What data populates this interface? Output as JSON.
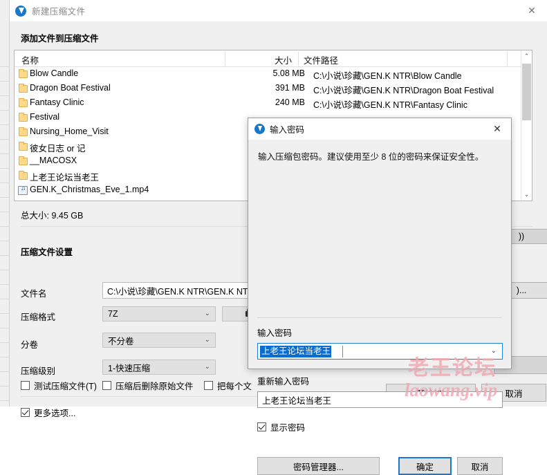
{
  "window": {
    "title": "新建压缩文件",
    "close_label": "✕",
    "section_title": "添加文件到压缩文件",
    "app_icon": "archiver-icon"
  },
  "filelist": {
    "columns": [
      "名称",
      "大小",
      "文件路径"
    ],
    "rows": [
      {
        "icon": "folder-icon",
        "name": "Blow Candle",
        "size": "5.08 MB",
        "path": "C:\\小说\\珍藏\\GEN.K NTR\\Blow Candle"
      },
      {
        "icon": "folder-icon",
        "name": "Dragon Boat Festival",
        "size": "391 MB",
        "path": "C:\\小说\\珍藏\\GEN.K NTR\\Dragon Boat Festival"
      },
      {
        "icon": "folder-icon",
        "name": "Fantasy Clinic",
        "size": "240 MB",
        "path": "C:\\小说\\珍藏\\GEN.K NTR\\Fantasy Clinic"
      },
      {
        "icon": "folder-icon",
        "name": "Festival",
        "size": "",
        "path": ""
      },
      {
        "icon": "folder-icon",
        "name": "Nursing_Home_Visit",
        "size": "",
        "path": ""
      },
      {
        "icon": "folder-icon",
        "name": "彼女日志 or 记",
        "size": "",
        "path": ""
      },
      {
        "icon": "folder-icon",
        "name": "__MACOSX",
        "size": "",
        "path": ""
      },
      {
        "icon": "folder-icon",
        "name": "上老王论坛当老王",
        "size": "",
        "path": ""
      },
      {
        "icon": "media-file-icon",
        "name": "GEN.K_Christmas_Eve_1.mp4",
        "size": "",
        "path": ""
      }
    ],
    "scroll_up": "⌃",
    "scroll_down": "⌄"
  },
  "summary": {
    "total_size": "总大小: 9.45 GB"
  },
  "settings": {
    "heading": "压缩文件设置",
    "filename_label": "文件名",
    "filename_value": "C:\\小说\\珍藏\\GEN.K NTR\\GEN.K NT",
    "format_label": "压缩格式",
    "format_value": "7Z",
    "lock_button": "lock-icon",
    "volume_label": "分卷",
    "volume_value": "不分卷",
    "level_label": "压缩级别",
    "level_value": "1-快速压缩",
    "check_test": "测试压缩文件(T)",
    "check_delete": "压缩后删除原始文件",
    "check_each": "把每个文",
    "more_options": "更多选项...",
    "caret": "⌄"
  },
  "bottom_buttons": {
    "start": "开始(S)",
    "cancel": "取消"
  },
  "behind_dialog": {
    "browse_button": ")...",
    "partial_button": "))"
  },
  "dialog": {
    "title": "输入密码",
    "close_label": "✕",
    "icon": "archiver-icon",
    "description": "输入压缩包密码。建议使用至少 8 位的密码来保证安全性。",
    "password_label": "输入密码",
    "password_value": "上老王论坛当老王",
    "password_caret": "⌄",
    "repeat_label": "重新输入密码",
    "repeat_value": "上老王论坛当老王",
    "show_password_label": "显示密码",
    "show_password_checked": true,
    "manager_button": "密码管理器...",
    "ok_button": "确定",
    "cancel_button": "取消"
  },
  "watermark": {
    "line1": "老王论坛",
    "line2": "laowang.vip",
    "color": "#f0a9b4"
  }
}
